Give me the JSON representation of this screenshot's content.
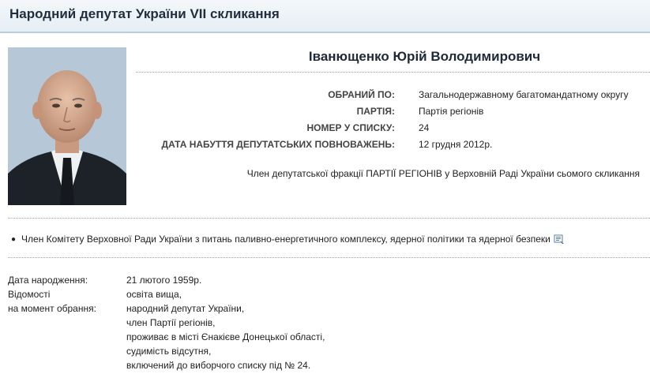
{
  "header": {
    "title": "Народний депутат України VII скликання"
  },
  "deputy": {
    "name": "Іванющенко Юрій Володимирович",
    "photo_alt": "portrait"
  },
  "info": {
    "elected_label": "ОБРАНИЙ ПО:",
    "elected_value": "Загальнодержавному багатомандатному округу",
    "party_label": "ПАРТІЯ:",
    "party_value": "Партія регіонів",
    "list_number_label": "НОМЕР У СПИСКУ:",
    "list_number_value": "24",
    "mandate_date_label": "ДАТА НАБУТТЯ ДЕПУТАТСЬКИХ ПОВНОВАЖЕНЬ:",
    "mandate_date_value": "12 грудня 2012р."
  },
  "faction": "Член депутатської фракції ПАРТІЇ РЕГІОНІВ у Верховній Раді України сьомого скликання",
  "committee": {
    "text": "Член Комітету Верховної Ради України з питань паливно-енергетичного комплексу, ядерної політики та ядерної безпеки",
    "icon": "document-icon"
  },
  "bio": {
    "birth_label": "Дата народження:",
    "birth_value": "21 лютого 1959р.",
    "info_label_1": "Відомості",
    "info_label_2": "на момент обрання:",
    "info_lines": [
      "освіта вища,",
      "народний депутат України,",
      "член Партії регіонів,",
      "проживає в місті Єнакієве Донецької області,",
      "судимість відсутня,",
      "включений до виборчого списку під № 24."
    ]
  }
}
